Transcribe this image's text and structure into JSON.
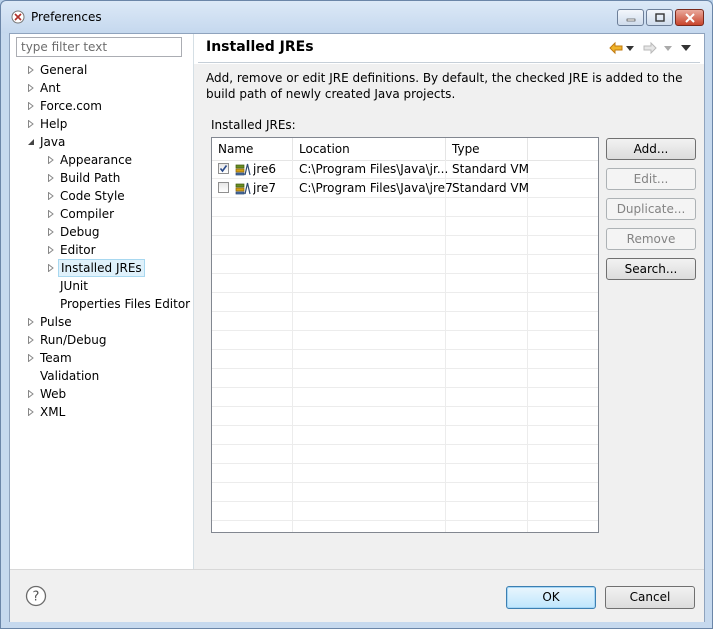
{
  "window": {
    "title": "Preferences"
  },
  "filter": {
    "placeholder": "type filter text"
  },
  "tree": [
    {
      "label": "General",
      "level": 0,
      "twisty": "collapsed"
    },
    {
      "label": "Ant",
      "level": 0,
      "twisty": "collapsed"
    },
    {
      "label": "Force.com",
      "level": 0,
      "twisty": "collapsed"
    },
    {
      "label": "Help",
      "level": 0,
      "twisty": "collapsed"
    },
    {
      "label": "Java",
      "level": 0,
      "twisty": "expanded"
    },
    {
      "label": "Appearance",
      "level": 1,
      "twisty": "collapsed"
    },
    {
      "label": "Build Path",
      "level": 1,
      "twisty": "collapsed"
    },
    {
      "label": "Code Style",
      "level": 1,
      "twisty": "collapsed"
    },
    {
      "label": "Compiler",
      "level": 1,
      "twisty": "collapsed"
    },
    {
      "label": "Debug",
      "level": 1,
      "twisty": "collapsed"
    },
    {
      "label": "Editor",
      "level": 1,
      "twisty": "collapsed"
    },
    {
      "label": "Installed JREs",
      "level": 1,
      "twisty": "collapsed",
      "selected": true
    },
    {
      "label": "JUnit",
      "level": 1,
      "twisty": "none"
    },
    {
      "label": "Properties Files Editor",
      "level": 1,
      "twisty": "none"
    },
    {
      "label": "Pulse",
      "level": 0,
      "twisty": "collapsed"
    },
    {
      "label": "Run/Debug",
      "level": 0,
      "twisty": "collapsed"
    },
    {
      "label": "Team",
      "level": 0,
      "twisty": "collapsed"
    },
    {
      "label": "Validation",
      "level": 0,
      "twisty": "none"
    },
    {
      "label": "Web",
      "level": 0,
      "twisty": "collapsed"
    },
    {
      "label": "XML",
      "level": 0,
      "twisty": "collapsed"
    }
  ],
  "page": {
    "title": "Installed JREs",
    "description": "Add, remove or edit JRE definitions. By default, the checked JRE is added to the build path of newly created Java projects.",
    "table_label": "Installed JREs:",
    "columns": [
      "Name",
      "Location",
      "Type"
    ],
    "rows": [
      {
        "name": "jre6",
        "location": "C:\\Program Files\\Java\\jr...",
        "type": "Standard VM",
        "checked": true
      },
      {
        "name": "jre7",
        "location": "C:\\Program Files\\Java\\jre7",
        "type": "Standard VM",
        "checked": false
      }
    ],
    "buttons": {
      "add": "Add...",
      "edit": "Edit...",
      "duplicate": "Duplicate...",
      "remove": "Remove",
      "search": "Search..."
    }
  },
  "footer": {
    "ok": "OK",
    "cancel": "Cancel"
  },
  "colors": {
    "selection": "#dff1fb",
    "selection_border": "#a8d8f0",
    "back_arrow": "#e8a317",
    "forward_arrow": "#c8c8c8"
  }
}
